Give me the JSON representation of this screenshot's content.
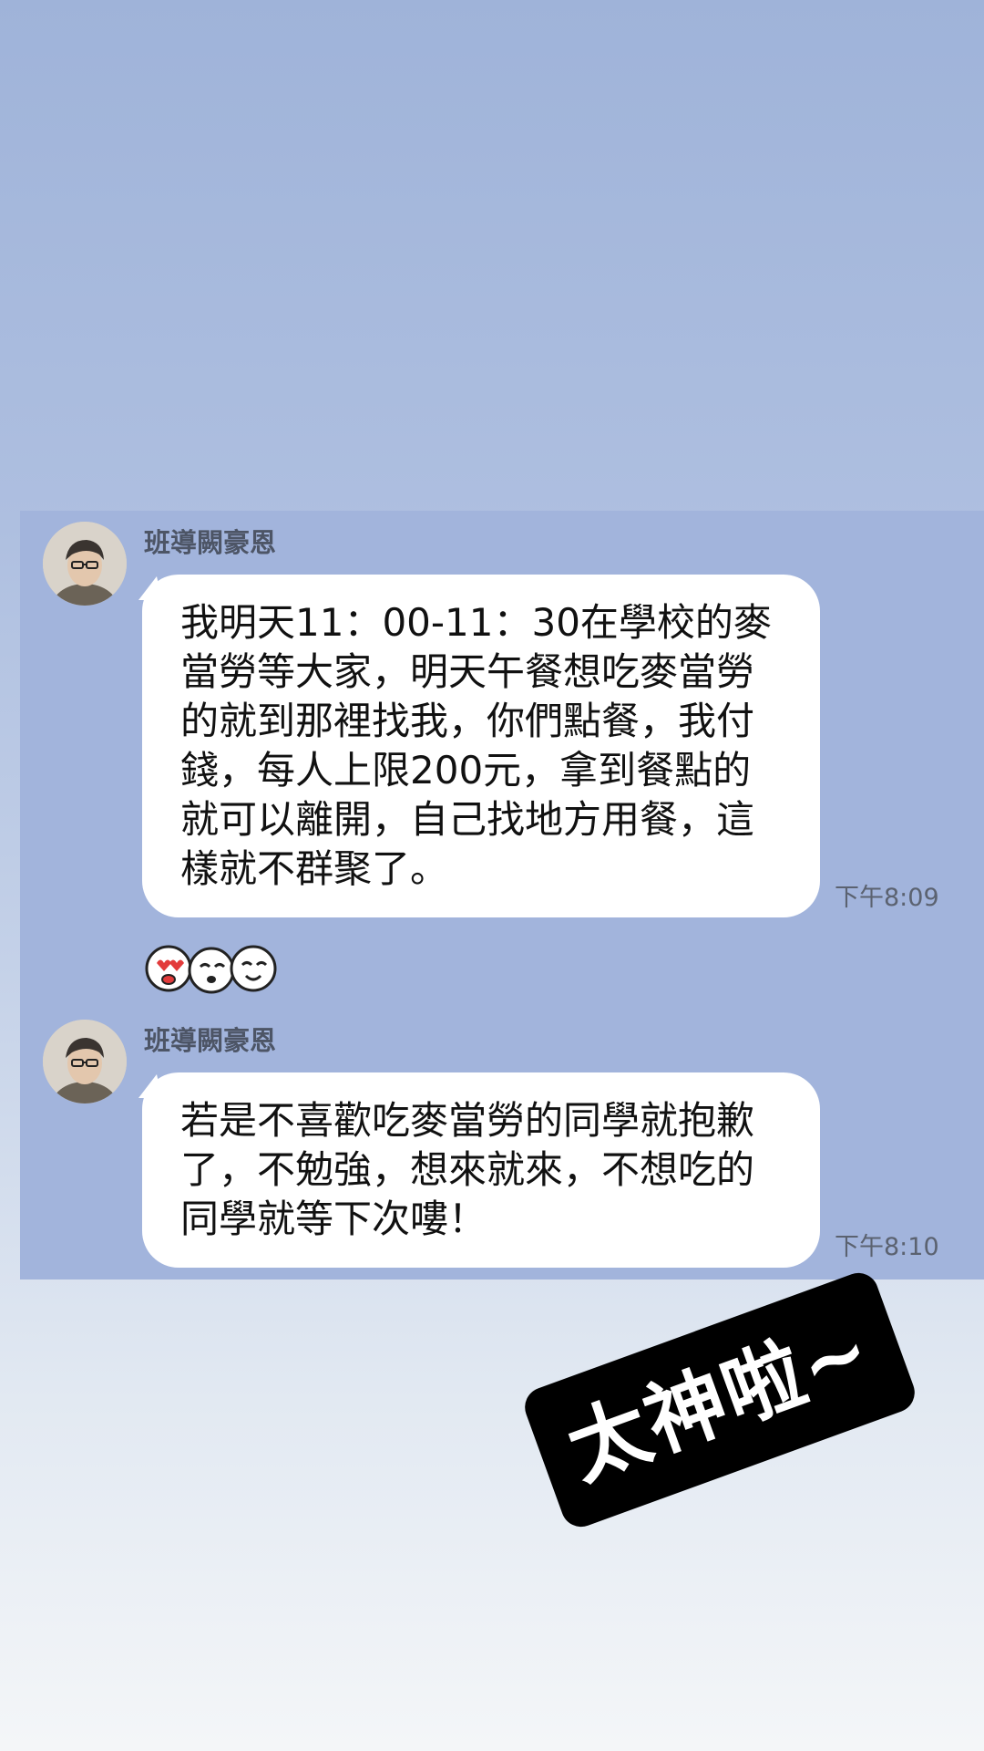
{
  "messages": [
    {
      "sender": "班導闕豪恩",
      "text": "我明天11：00-11：30在學校的麥當勞等大家，明天午餐想吃麥當勞的就到那裡找我，你們點餐，我付錢，每人上限200元，拿到餐點的就可以離開，自己找地方用餐，這樣就不群聚了。",
      "time": "下午8:09"
    },
    {
      "sender": "班導闕豪恩",
      "text": "若是不喜歡吃麥當勞的同學就抱歉了，不勉強，想來就來，不想吃的同學就等下次嘍！",
      "time": "下午8:10"
    }
  ],
  "stickers": [
    "heart-eyes-face-icon",
    "crying-face-icon",
    "smiling-face-icon"
  ],
  "overlay": {
    "caption": "太神啦~"
  }
}
